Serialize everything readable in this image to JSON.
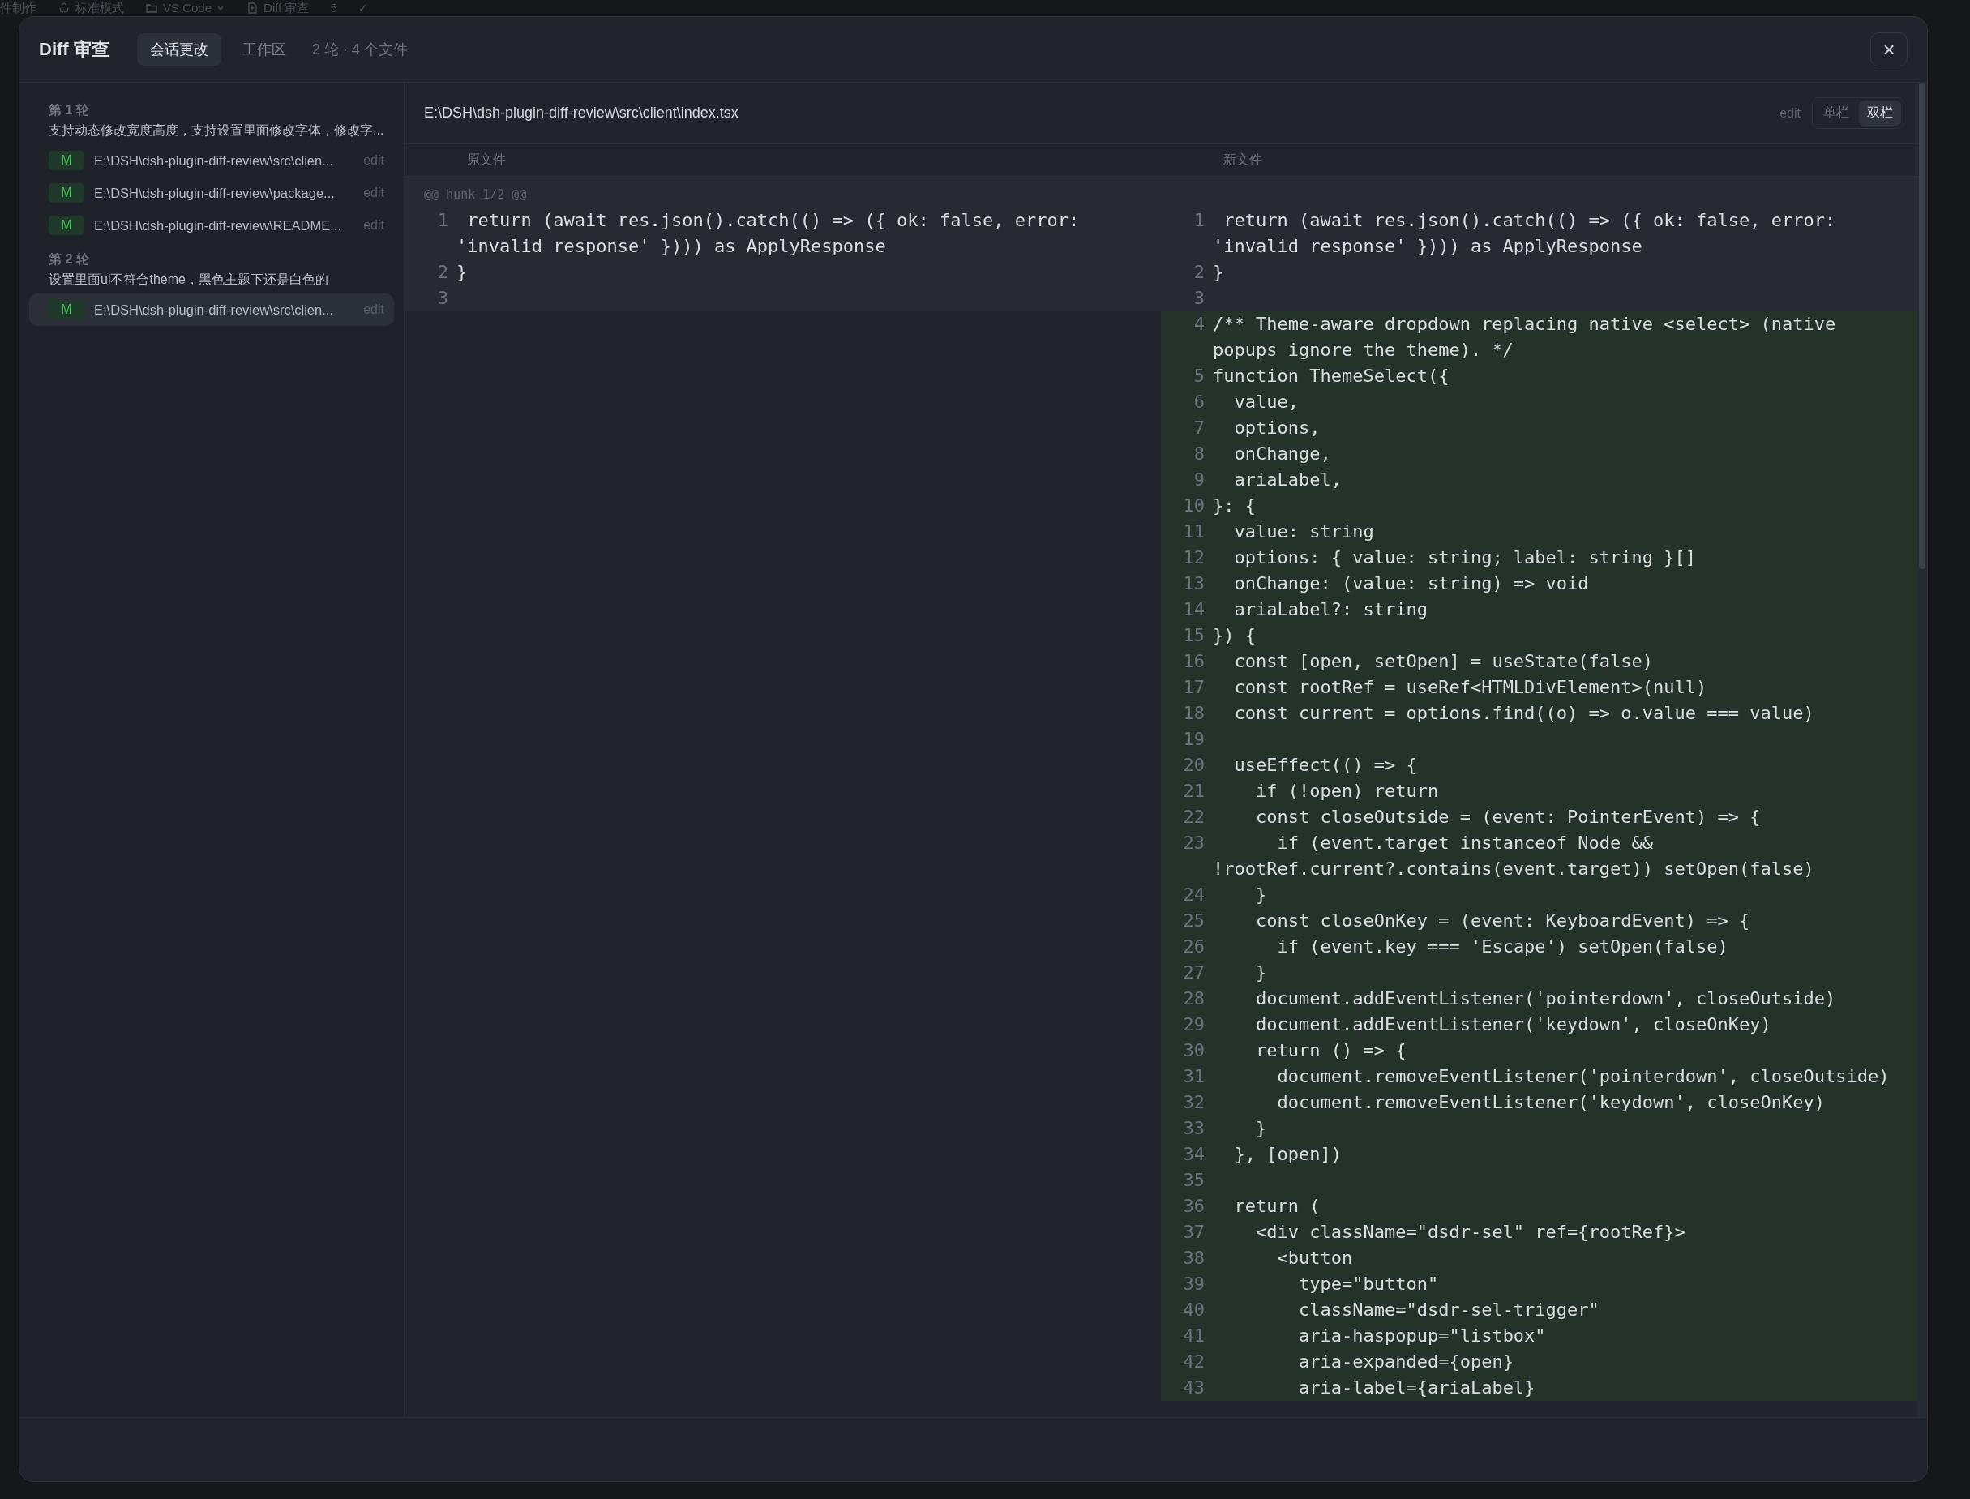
{
  "top_strip": [
    {
      "kind": "text",
      "label": "件制作"
    },
    {
      "kind": "mode",
      "label": "标准模式"
    },
    {
      "kind": "folder",
      "label": "VS Code"
    },
    {
      "kind": "file",
      "label": "Diff 审查"
    },
    {
      "kind": "text",
      "label": "5"
    },
    {
      "kind": "text",
      "label": "✓"
    }
  ],
  "dialog": {
    "title": "Diff 审查",
    "tabs": [
      {
        "label": "会话更改",
        "selected": true
      },
      {
        "label": "工作区",
        "selected": false
      }
    ],
    "summary": "2 轮 · 4 个文件",
    "close": "×"
  },
  "sidebar": {
    "rounds": [
      {
        "title": "第 1 轮",
        "description": "支持动态修改宽度高度，支持设置里面修改字体，修改字...",
        "files": [
          {
            "badge": "M",
            "path": "E:\\DSH\\dsh-plugin-diff-review\\src\\clien...",
            "action": "edit",
            "selected": false
          },
          {
            "badge": "M",
            "path": "E:\\DSH\\dsh-plugin-diff-review\\package...",
            "action": "edit",
            "selected": false
          },
          {
            "badge": "M",
            "path": "E:\\DSH\\dsh-plugin-diff-review\\README...",
            "action": "edit",
            "selected": false
          }
        ]
      },
      {
        "title": "第 2 轮",
        "description": "设置里面ui不符合theme，黑色主题下还是白色的",
        "files": [
          {
            "badge": "M",
            "path": "E:\\DSH\\dsh-plugin-diff-review\\src\\clien...",
            "action": "edit",
            "selected": true
          }
        ]
      }
    ]
  },
  "file_view": {
    "path": "E:\\DSH\\dsh-plugin-diff-review\\src\\client\\index.tsx",
    "action": "edit",
    "views": [
      {
        "label": "单栏",
        "selected": false
      },
      {
        "label": "双栏",
        "selected": true
      }
    ],
    "old_header": "原文件",
    "new_header": "新文件",
    "hunk": "@@ hunk 1/2 @@",
    "old_lines": [
      {
        "n": "1",
        "kind": "context",
        "text": " return (await res.json().catch(() => ({ ok: false, error: 'invalid response' }))) as ApplyResponse"
      },
      {
        "n": "2",
        "kind": "context",
        "text": "}"
      },
      {
        "n": "3",
        "kind": "context"
      }
    ],
    "new_lines": [
      {
        "n": "1",
        "kind": "context",
        "text": " return (await res.json().catch(() => ({ ok: false, error: 'invalid response' }))) as ApplyResponse"
      },
      {
        "n": "2",
        "kind": "context",
        "text": "}"
      },
      {
        "n": "3",
        "kind": "context"
      },
      {
        "n": "4",
        "kind": "added",
        "text": "/** Theme-aware dropdown replacing native <select> (native popups ignore the theme). */"
      },
      {
        "n": "5",
        "kind": "added",
        "text": "function ThemeSelect({"
      },
      {
        "n": "6",
        "kind": "added",
        "text": "  value,"
      },
      {
        "n": "7",
        "kind": "added",
        "text": "  options,"
      },
      {
        "n": "8",
        "kind": "added",
        "text": "  onChange,"
      },
      {
        "n": "9",
        "kind": "added",
        "text": "  ariaLabel,"
      },
      {
        "n": "10",
        "kind": "added",
        "text": "}: {"
      },
      {
        "n": "11",
        "kind": "added",
        "text": "  value: string"
      },
      {
        "n": "12",
        "kind": "added",
        "text": "  options: { value: string; label: string }[]"
      },
      {
        "n": "13",
        "kind": "added",
        "text": "  onChange: (value: string) => void"
      },
      {
        "n": "14",
        "kind": "added",
        "text": "  ariaLabel?: string"
      },
      {
        "n": "15",
        "kind": "added",
        "text": "}) {"
      },
      {
        "n": "16",
        "kind": "added",
        "text": "  const [open, setOpen] = useState(false)"
      },
      {
        "n": "17",
        "kind": "added",
        "text": "  const rootRef = useRef<HTMLDivElement>(null)"
      },
      {
        "n": "18",
        "kind": "added",
        "text": "  const current = options.find((o) => o.value === value)"
      },
      {
        "n": "19",
        "kind": "added"
      },
      {
        "n": "20",
        "kind": "added",
        "text": "  useEffect(() => {"
      },
      {
        "n": "21",
        "kind": "added",
        "text": "    if (!open) return"
      },
      {
        "n": "22",
        "kind": "added",
        "text": "    const closeOutside = (event: PointerEvent) => {"
      },
      {
        "n": "23",
        "kind": "added",
        "text": "      if (event.target instanceof Node && !rootRef.current?.contains(event.target)) setOpen(false)"
      },
      {
        "n": "24",
        "kind": "added",
        "text": "    }"
      },
      {
        "n": "25",
        "kind": "added",
        "text": "    const closeOnKey = (event: KeyboardEvent) => {"
      },
      {
        "n": "26",
        "kind": "added",
        "text": "      if (event.key === 'Escape') setOpen(false)"
      },
      {
        "n": "27",
        "kind": "added",
        "text": "    }"
      },
      {
        "n": "28",
        "kind": "added",
        "text": "    document.addEventListener('pointerdown', closeOutside)"
      },
      {
        "n": "29",
        "kind": "added",
        "text": "    document.addEventListener('keydown', closeOnKey)"
      },
      {
        "n": "30",
        "kind": "added",
        "text": "    return () => {"
      },
      {
        "n": "31",
        "kind": "added",
        "text": "      document.removeEventListener('pointerdown', closeOutside)"
      },
      {
        "n": "32",
        "kind": "added",
        "text": "      document.removeEventListener('keydown', closeOnKey)"
      },
      {
        "n": "33",
        "kind": "added",
        "text": "    }"
      },
      {
        "n": "34",
        "kind": "added",
        "text": "  }, [open])"
      },
      {
        "n": "35",
        "kind": "added"
      },
      {
        "n": "36",
        "kind": "added",
        "text": "  return ("
      },
      {
        "n": "37",
        "kind": "added",
        "text": "    <div className=\"dsdr-sel\" ref={rootRef}>"
      },
      {
        "n": "38",
        "kind": "added",
        "text": "      <button"
      },
      {
        "n": "39",
        "kind": "added",
        "text": "        type=\"button\""
      },
      {
        "n": "40",
        "kind": "added",
        "text": "        className=\"dsdr-sel-trigger\""
      },
      {
        "n": "41",
        "kind": "added",
        "text": "        aria-haspopup=\"listbox\""
      },
      {
        "n": "42",
        "kind": "added",
        "text": "        aria-expanded={open}"
      },
      {
        "n": "43",
        "kind": "added",
        "text": "        aria-label={ariaLabel}"
      }
    ]
  }
}
